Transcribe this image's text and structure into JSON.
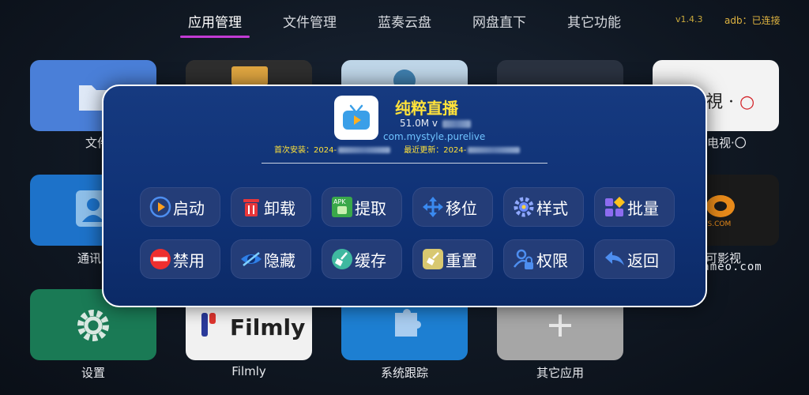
{
  "nav": {
    "tabs": [
      {
        "label": "应用管理",
        "active": true
      },
      {
        "label": "文件管理"
      },
      {
        "label": "蓝奏云盘"
      },
      {
        "label": "网盘直下"
      },
      {
        "label": "其它功能"
      }
    ],
    "version": "v1.4.3",
    "adb_status": "adb：已连接"
  },
  "tiles": {
    "files_label": "文件",
    "tv_text": "電視 · ",
    "tv_label": "电视·〇",
    "contacts_label": "通讯",
    "ys_text": "YS.COM",
    "ys_label": "可影视",
    "settings_label": "设置",
    "filmly_text": "Filmly",
    "filmly_label": "Filmly",
    "trace_label": "系统跟踪",
    "other_label": "其它应用"
  },
  "dialog": {
    "app_name": "纯粹直播",
    "size": "51.0M",
    "version_prefix": "v",
    "package": "com.mystyle.purelive",
    "install_label": "首次安装：2024-",
    "update_label": "最近更新：2024-",
    "apk_text": "APK",
    "buttons": [
      {
        "label": "启动",
        "icon": "play-icon"
      },
      {
        "label": "卸载",
        "icon": "trash-icon"
      },
      {
        "label": "提取",
        "icon": "apk-icon"
      },
      {
        "label": "移位",
        "icon": "move-icon"
      },
      {
        "label": "样式",
        "icon": "gear-style-icon"
      },
      {
        "label": "批量",
        "icon": "batch-icon"
      },
      {
        "label": "禁用",
        "icon": "forbid-icon"
      },
      {
        "label": "隐藏",
        "icon": "eye-hide-icon"
      },
      {
        "label": "缓存",
        "icon": "broom-icon"
      },
      {
        "label": "重置",
        "icon": "brush-icon"
      },
      {
        "label": "权限",
        "icon": "lock-user-icon"
      },
      {
        "label": "返回",
        "icon": "back-arrow-icon"
      }
    ]
  },
  "watermark": "Fsgameo.com",
  "colors": {
    "accent_underline": "#c23bd4",
    "title_yellow": "#ffe23a",
    "package_blue": "#6fc3ff",
    "dialog_bg": "#0f3175"
  }
}
